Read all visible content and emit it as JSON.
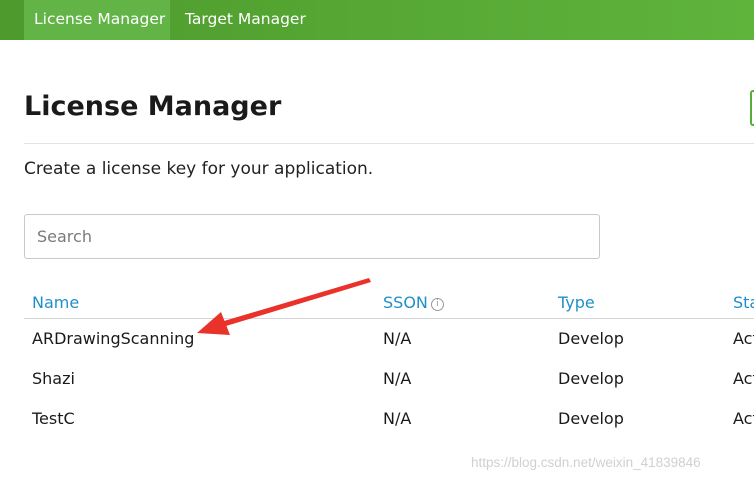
{
  "nav": {
    "tabs": [
      {
        "label": "License Manager",
        "active": true
      },
      {
        "label": "Target Manager",
        "active": false
      }
    ]
  },
  "header": {
    "title": "License Manager",
    "subtitle": "Create a license key for your application."
  },
  "search": {
    "placeholder": "Search",
    "value": ""
  },
  "table": {
    "columns": [
      "Name",
      "SSON",
      "Type",
      "Sta"
    ],
    "rows": [
      {
        "name": "ARDrawingScanning",
        "sson": "N/A",
        "type": "Develop",
        "status": "Act"
      },
      {
        "name": "Shazi",
        "sson": "N/A",
        "type": "Develop",
        "status": "Act"
      },
      {
        "name": "TestC",
        "sson": "N/A",
        "type": "Develop",
        "status": "Act"
      }
    ]
  },
  "icons": {
    "sson_info": "info-icon",
    "annotation": "red-arrow"
  },
  "colors": {
    "nav_green": "#57a935",
    "active_tab": "#62b446",
    "link_blue": "#1f8fc9",
    "annotation_red": "#e8322a"
  },
  "watermark": "https://blog.csdn.net/weixin_41839846"
}
